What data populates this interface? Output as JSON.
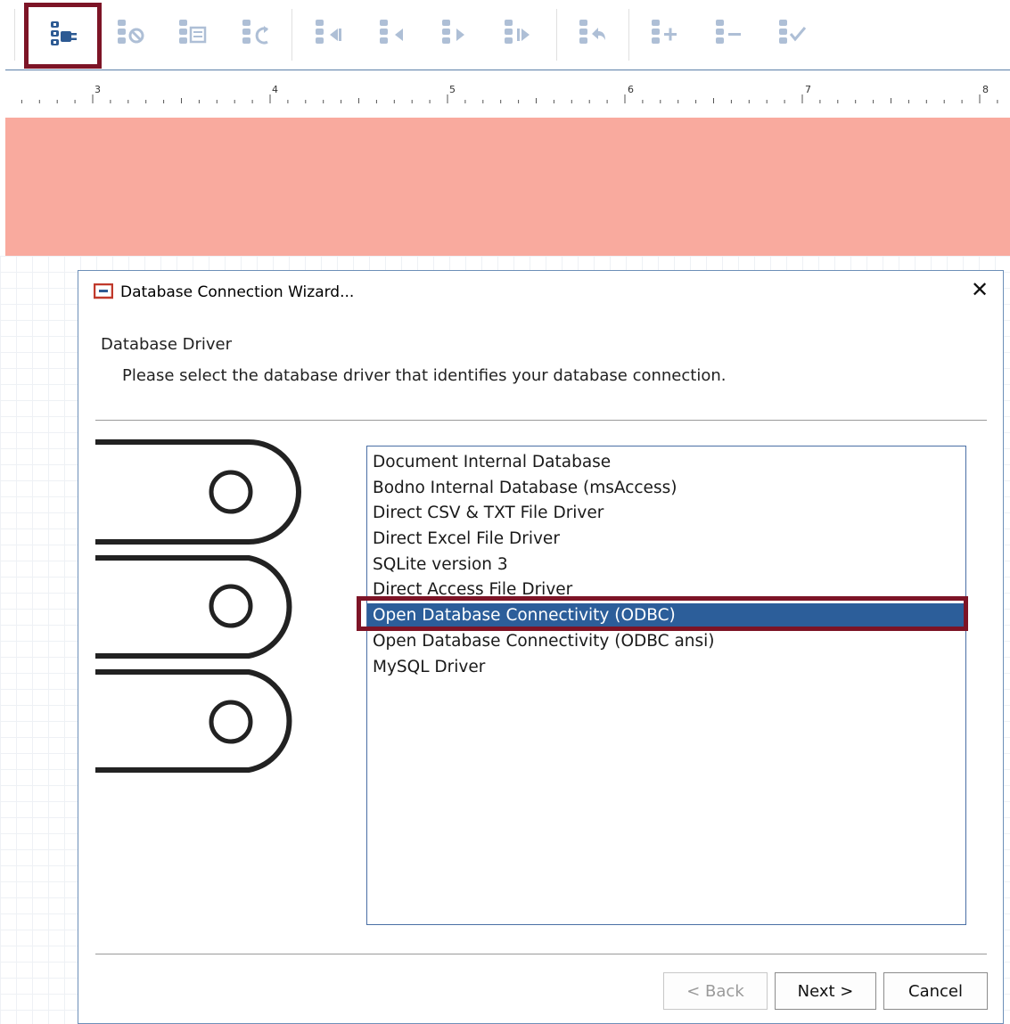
{
  "toolbar": {
    "buttons": [
      {
        "name": "connect-database-icon",
        "active": true
      },
      {
        "name": "disconnect-database-icon",
        "active": false
      },
      {
        "name": "database-table-icon",
        "active": false
      },
      {
        "name": "refresh-database-icon",
        "active": false
      },
      {
        "name": "first-record-icon",
        "active": false
      },
      {
        "name": "previous-record-icon",
        "active": false
      },
      {
        "name": "next-record-icon",
        "active": false
      },
      {
        "name": "last-record-icon",
        "active": false
      },
      {
        "name": "undo-record-icon",
        "active": false
      },
      {
        "name": "add-record-icon",
        "active": false
      },
      {
        "name": "delete-record-icon",
        "active": false
      },
      {
        "name": "confirm-record-icon",
        "active": false
      }
    ]
  },
  "ruler": {
    "labels": [
      "3",
      "4",
      "5",
      "6",
      "7",
      "8"
    ]
  },
  "colors": {
    "band": "#f9aa9e",
    "selection": "#2c5e9a",
    "highlight_border": "#7d1426"
  },
  "dialog": {
    "title": "Database Connection Wizard...",
    "close_glyph": "✕",
    "heading": "Database Driver",
    "description": "Please select the database driver that identifies your database connection.",
    "drivers": [
      "Document Internal Database",
      "Bodno Internal Database (msAccess)",
      "Direct CSV & TXT File Driver",
      "Direct Excel File Driver",
      "SQLite version 3",
      "Direct Access File Driver",
      "Open Database Connectivity (ODBC)",
      "Open Database Connectivity (ODBC ansi)",
      "MySQL Driver"
    ],
    "selected_driver": "Open Database Connectivity (ODBC)",
    "buttons": {
      "back": "< Back",
      "next": "Next >",
      "cancel": "Cancel"
    }
  }
}
